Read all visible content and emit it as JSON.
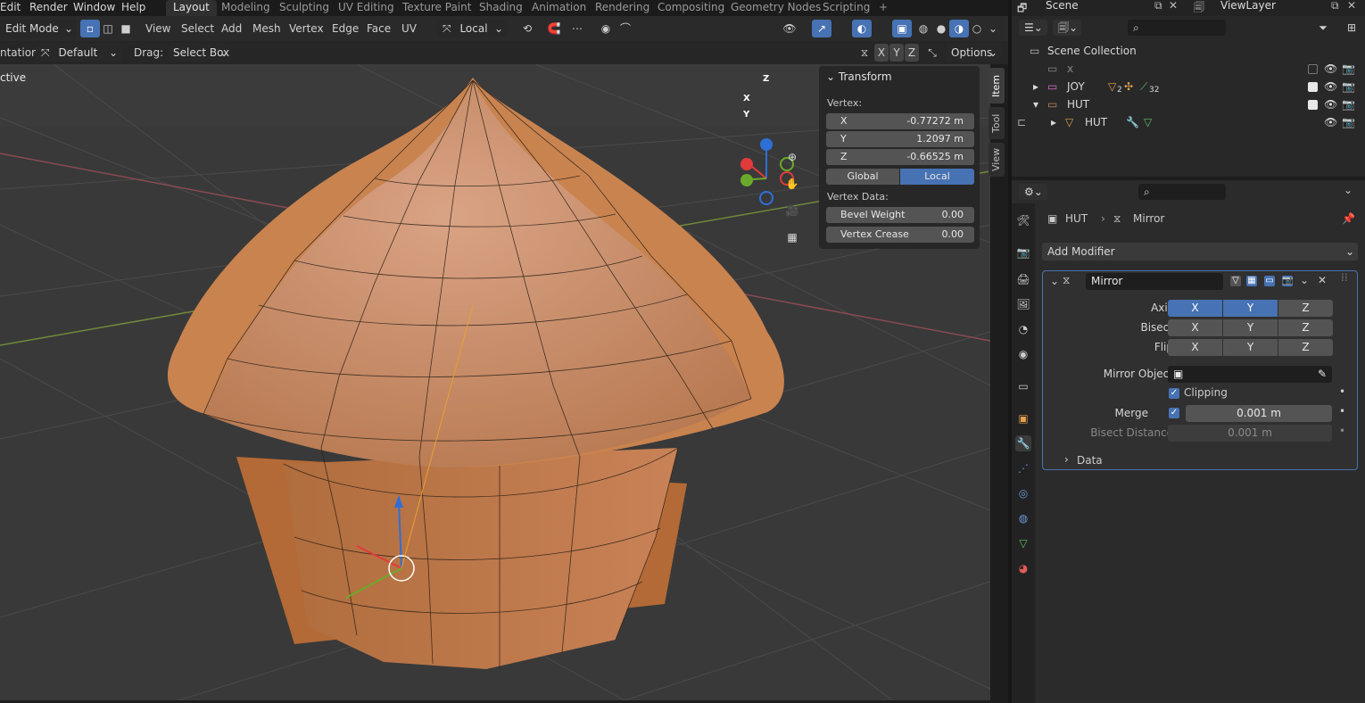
{
  "menu": [
    "Edit",
    "Render",
    "Window",
    "Help"
  ],
  "workspaces": [
    "Layout",
    "Modeling",
    "Sculpting",
    "UV Editing",
    "Texture Paint",
    "Shading",
    "Animation",
    "Rendering",
    "Compositing",
    "Geometry Nodes",
    "Scripting"
  ],
  "add_workspace": "+",
  "header": {
    "mode": "Edit Mode",
    "menus": [
      "View",
      "Select",
      "Add",
      "Mesh",
      "Vertex",
      "Edge",
      "Face",
      "UV"
    ],
    "orientation": "Local",
    "options": "Options"
  },
  "toolsettings": {
    "orientation_label": "ntation:",
    "orientation_value": "Default",
    "drag_label": "Drag:",
    "drag_value": "Select Box",
    "axis": [
      "X",
      "Y",
      "Z"
    ]
  },
  "viewport": {
    "label": "ctive",
    "gizmo_axes": [
      "Z",
      "X",
      "Y"
    ]
  },
  "npanel": {
    "title": "Transform",
    "vertex_label": "Vertex:",
    "x_label": "X",
    "x_value": "-0.77272 m",
    "y_label": "Y",
    "y_value": "1.2097 m",
    "z_label": "Z",
    "z_value": "-0.66525 m",
    "global": "Global",
    "local": "Local",
    "vertex_data_label": "Vertex Data:",
    "bevel_label": "Bevel Weight",
    "bevel_value": "0.00",
    "crease_label": "Vertex Crease",
    "crease_value": "0.00"
  },
  "sidetabs": [
    "Item",
    "Tool",
    "View"
  ],
  "scene": {
    "scene_label": "Scene",
    "viewlayer_label": "ViewLayer"
  },
  "outliner": {
    "collection": "Scene Collection",
    "rows": [
      {
        "name": "x"
      },
      {
        "name": "JOY",
        "badge1": "2",
        "badge2": "32"
      },
      {
        "name": "HUT"
      },
      {
        "name": "HUT"
      }
    ]
  },
  "properties": {
    "breadcrumb_object": "HUT",
    "breadcrumb_modifier": "Mirror",
    "add_modifier": "Add Modifier",
    "modifier_name": "Mirror",
    "axis_label": "Axis",
    "bisect_label": "Bisect",
    "flip_label": "Flip",
    "xyz": [
      "X",
      "Y",
      "Z"
    ],
    "mirror_object_label": "Mirror Object",
    "clipping_label": "Clipping",
    "merge_label": "Merge",
    "merge_value": "0.001 m",
    "bisect_distance_label": "Bisect Distance",
    "bisect_distance_value": "0.001 m",
    "data_label": "Data"
  },
  "colors": {
    "accent": "#4772b3",
    "mesh": "#c98a63",
    "grid_bg": "#393939"
  }
}
